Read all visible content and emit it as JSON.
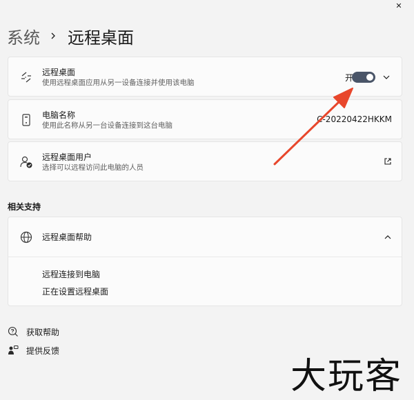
{
  "window": {
    "close_glyph": "✕"
  },
  "breadcrumb": {
    "parent": "系统",
    "current": "远程桌面"
  },
  "remote_desktop": {
    "title": "远程桌面",
    "subtitle": "使用远程桌面应用从另一设备连接并使用该电脑",
    "toggle_label": "开",
    "toggle_on": true,
    "icon": "remote-desktop-icon"
  },
  "pc_name": {
    "title": "电脑名称",
    "subtitle": "使用此名称从另一台设备连接到这台电脑",
    "value": "C-20220422HKKM",
    "icon": "pc-name-icon"
  },
  "remote_users": {
    "title": "远程桌面用户",
    "subtitle": "选择可以远程访问此电脑的人员",
    "icon": "remote-users-icon"
  },
  "related": {
    "section_title": "相关支持",
    "help_title": "远程桌面帮助",
    "links": [
      "远程连接到电脑",
      "正在设置远程桌面"
    ]
  },
  "footer": {
    "get_help": "获取帮助",
    "feedback": "提供反馈"
  },
  "watermark": {
    "text": "大玩客"
  },
  "colors": {
    "arrow": "#e8472c",
    "toggle": "#4a5568"
  }
}
